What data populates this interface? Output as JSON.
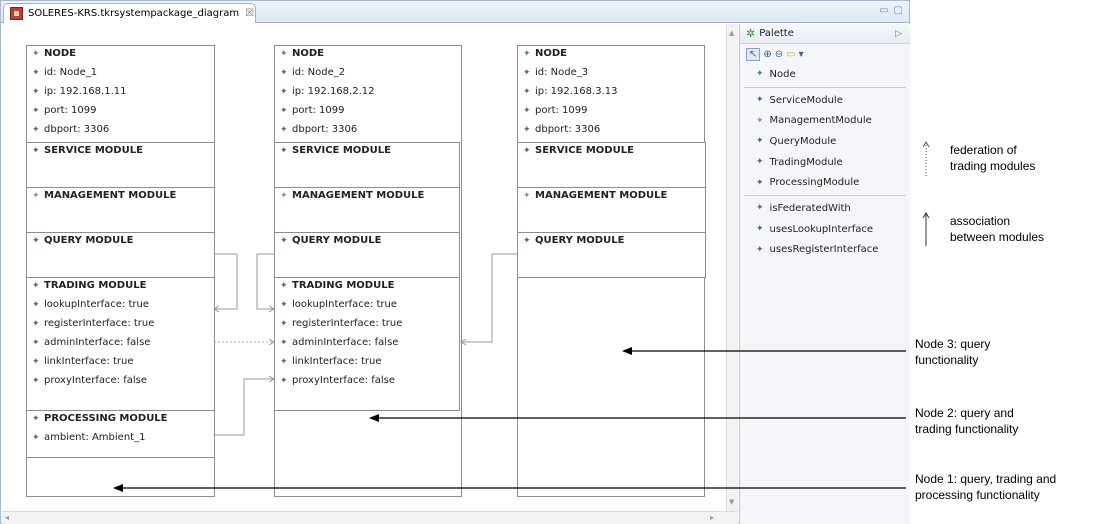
{
  "window": {
    "tab_title": "SOLERES-KRS.tkrsystempackage_diagram",
    "tab_close": "☒",
    "controls": [
      "▭",
      "▢"
    ]
  },
  "palette": {
    "title": "Palette",
    "tools": [
      "↖",
      "⊕",
      "⊖",
      "▭",
      "▾"
    ],
    "groups": [
      [
        {
          "label": "Node",
          "color": "green"
        }
      ],
      [
        {
          "label": "ServiceModule",
          "color": "blue"
        },
        {
          "label": "ManagementModule",
          "color": "pink"
        },
        {
          "label": "QueryModule",
          "color": "blue"
        },
        {
          "label": "TradingModule",
          "color": "gray"
        },
        {
          "label": "ProcessingModule",
          "color": "gray"
        }
      ],
      [
        {
          "label": "isFederatedWith",
          "color": "gray"
        },
        {
          "label": "usesLookupInterface",
          "color": "blue"
        },
        {
          "label": "usesRegisterInterface",
          "color": "gray"
        }
      ]
    ]
  },
  "nodes": [
    {
      "header": "NODE",
      "props": [
        "id: Node_1",
        "ip: 192.168.1.11",
        "port: 1099",
        "dbport: 3306"
      ],
      "service": "SERVICE MODULE",
      "management": "MANAGEMENT MODULE",
      "query": "QUERY MODULE",
      "trading": {
        "title": "TRADING MODULE",
        "props": [
          "lookupInterface: true",
          "registerInterface: true",
          "adminInterface: false",
          "linkInterface: true",
          "proxyInterface: false"
        ]
      },
      "processing": {
        "title": "PROCESSING MODULE",
        "props": [
          "ambient: Ambient_1"
        ]
      }
    },
    {
      "header": "NODE",
      "props": [
        "id: Node_2",
        "ip: 192.168.2.12",
        "port: 1099",
        "dbport: 3306"
      ],
      "service": "SERVICE MODULE",
      "management": "MANAGEMENT MODULE",
      "query": "QUERY MODULE",
      "trading": {
        "title": "TRADING MODULE",
        "props": [
          "lookupInterface: true",
          "registerInterface: true",
          "adminInterface: false",
          "linkInterface: true",
          "proxyInterface: false"
        ]
      }
    },
    {
      "header": "NODE",
      "props": [
        "id: Node_3",
        "ip: 192.168.3.13",
        "port: 1099",
        "dbport: 3306"
      ],
      "service": "SERVICE MODULE",
      "management": "MANAGEMENT MODULE",
      "query": "QUERY MODULE"
    }
  ],
  "legend": {
    "federation": [
      "federation of",
      "trading modules"
    ],
    "association": [
      "association",
      "between modules"
    ]
  },
  "annotations": {
    "node3": [
      "Node 3: query",
      "functionality"
    ],
    "node2": [
      "Node 2: query and",
      "trading functionality"
    ],
    "node1": [
      "Node 1: query, trading and",
      "processing functionality"
    ]
  },
  "colors": {
    "green": "#3f9b4a",
    "blue": "#3f5fa8",
    "pink": "#b07ab8",
    "gray": "#666666",
    "tab_border": "#9fb2cc"
  }
}
